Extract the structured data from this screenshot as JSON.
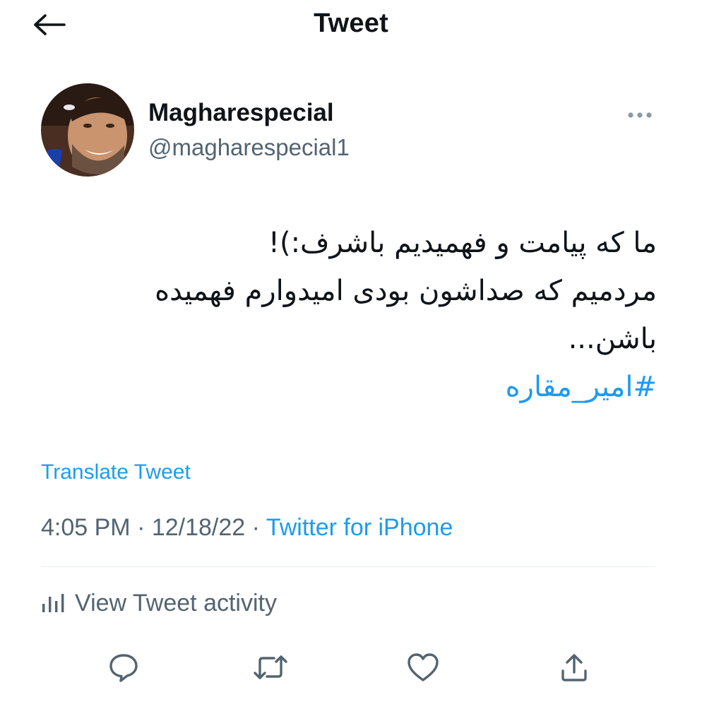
{
  "header": {
    "title": "Tweet",
    "back_icon": "arrow-left-icon"
  },
  "author": {
    "display_name": "Magharespecial",
    "handle": "@magharespecial1",
    "more_icon": "more-horizontal-icon"
  },
  "tweet": {
    "lines": [
      "ما که پیامت و فهمیدیم باشرف:)!",
      "مردمیم که صداشون بودی امیدوارم فهمیده",
      "باشن..."
    ],
    "hashtag": "#امیر_مقاره"
  },
  "translate_label": "Translate Tweet",
  "meta": {
    "time": "4:05 PM",
    "separator": " · ",
    "date": "12/18/22",
    "source": "Twitter for iPhone"
  },
  "activity_label": "View Tweet activity",
  "actions": [
    {
      "icon": "reply-icon"
    },
    {
      "icon": "retweet-icon"
    },
    {
      "icon": "like-icon"
    },
    {
      "icon": "share-icon"
    }
  ],
  "colors": {
    "accent": "#1d9bf0",
    "text": "#0f1419",
    "muted": "#536471"
  }
}
